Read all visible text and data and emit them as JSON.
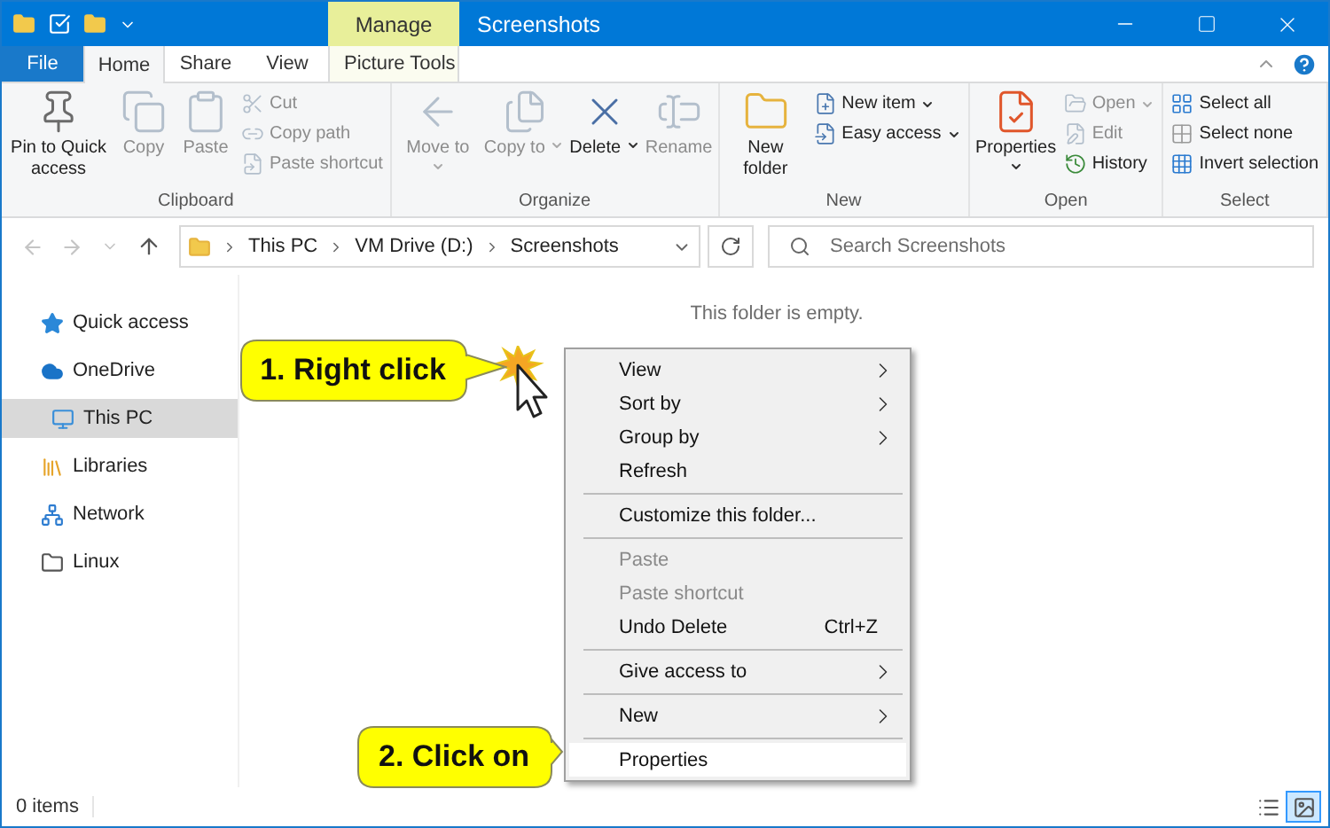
{
  "title_bar": {
    "contextual_tab": "Manage",
    "title": "Screenshots"
  },
  "ribbon_tabs": [
    {
      "label": "File",
      "kind": "file",
      "selected": false
    },
    {
      "label": "Home",
      "kind": "normal",
      "selected": true
    },
    {
      "label": "Share",
      "kind": "normal",
      "selected": false
    },
    {
      "label": "View",
      "kind": "normal",
      "selected": false
    },
    {
      "label": "Picture Tools",
      "kind": "contextual",
      "selected": false
    }
  ],
  "ribbon_groups": [
    {
      "label": "Clipboard",
      "items": [
        {
          "kind": "large",
          "label": "Pin to Quick access",
          "disabled": false,
          "dropdown": false
        },
        {
          "kind": "large",
          "label": "Copy",
          "disabled": true,
          "dropdown": false
        },
        {
          "kind": "large",
          "label": "Paste",
          "disabled": true,
          "dropdown": false
        },
        {
          "kind": "small",
          "label": "Cut",
          "disabled": true,
          "dropdown": false
        },
        {
          "kind": "small",
          "label": "Copy path",
          "disabled": true,
          "dropdown": false
        },
        {
          "kind": "small",
          "label": "Paste shortcut",
          "disabled": true,
          "dropdown": false
        }
      ]
    },
    {
      "label": "Organize",
      "items": [
        {
          "kind": "large",
          "label": "Move to",
          "disabled": true,
          "dropdown": true
        },
        {
          "kind": "large",
          "label": "Copy to",
          "disabled": true,
          "dropdown": true
        },
        {
          "kind": "large",
          "label": "Delete",
          "disabled": false,
          "dropdown": true
        },
        {
          "kind": "large",
          "label": "Rename",
          "disabled": true,
          "dropdown": false
        }
      ]
    },
    {
      "label": "New",
      "items": [
        {
          "kind": "large",
          "label": "New folder",
          "disabled": false,
          "dropdown": false
        },
        {
          "kind": "small",
          "label": "New item",
          "disabled": false,
          "dropdown": true
        },
        {
          "kind": "small",
          "label": "Easy access",
          "disabled": false,
          "dropdown": true
        }
      ]
    },
    {
      "label": "Open",
      "items": [
        {
          "kind": "large",
          "label": "Properties",
          "disabled": false,
          "dropdown": true
        },
        {
          "kind": "small",
          "label": "Open",
          "disabled": true,
          "dropdown": true
        },
        {
          "kind": "small",
          "label": "Edit",
          "disabled": true,
          "dropdown": false
        },
        {
          "kind": "small",
          "label": "History",
          "disabled": false,
          "dropdown": false
        }
      ]
    },
    {
      "label": "Select",
      "items": [
        {
          "kind": "small",
          "label": "Select all",
          "disabled": false,
          "dropdown": false
        },
        {
          "kind": "small",
          "label": "Select none",
          "disabled": false,
          "dropdown": false
        },
        {
          "kind": "small",
          "label": "Invert selection",
          "disabled": false,
          "dropdown": false
        }
      ]
    }
  ],
  "address_bar": {
    "path": [
      "This PC",
      "VM Drive (D:)",
      "Screenshots"
    ]
  },
  "search": {
    "placeholder": "Search Screenshots"
  },
  "navigation": [
    {
      "label": "Quick access",
      "selected": false
    },
    {
      "label": "OneDrive",
      "selected": false
    },
    {
      "label": "This PC",
      "selected": true
    },
    {
      "label": "Libraries",
      "selected": false
    },
    {
      "label": "Network",
      "selected": false
    },
    {
      "label": "Linux",
      "selected": false
    }
  ],
  "content": {
    "empty_message": "This folder is empty."
  },
  "context_menu": [
    {
      "kind": "item",
      "label": "View",
      "submenu": true,
      "disabled": false,
      "selected": false
    },
    {
      "kind": "item",
      "label": "Sort by",
      "submenu": true,
      "disabled": false,
      "selected": false
    },
    {
      "kind": "item",
      "label": "Group by",
      "submenu": true,
      "disabled": false,
      "selected": false
    },
    {
      "kind": "item",
      "label": "Refresh",
      "submenu": false,
      "disabled": false,
      "selected": false
    },
    {
      "kind": "separator"
    },
    {
      "kind": "item",
      "label": "Customize this folder...",
      "submenu": false,
      "disabled": false,
      "selected": false
    },
    {
      "kind": "separator"
    },
    {
      "kind": "item",
      "label": "Paste",
      "submenu": false,
      "disabled": true,
      "selected": false
    },
    {
      "kind": "item",
      "label": "Paste shortcut",
      "submenu": false,
      "disabled": true,
      "selected": false
    },
    {
      "kind": "item",
      "label": "Undo Delete",
      "submenu": false,
      "disabled": false,
      "selected": false,
      "shortcut": "Ctrl+Z"
    },
    {
      "kind": "separator"
    },
    {
      "kind": "item",
      "label": "Give access to",
      "submenu": true,
      "disabled": false,
      "selected": false
    },
    {
      "kind": "separator"
    },
    {
      "kind": "item",
      "label": "New",
      "submenu": true,
      "disabled": false,
      "selected": false
    },
    {
      "kind": "separator"
    },
    {
      "kind": "item",
      "label": "Properties",
      "submenu": false,
      "disabled": false,
      "selected": true
    }
  ],
  "callouts": [
    {
      "text": "1. Right click"
    },
    {
      "text": "2. Click on"
    }
  ],
  "status_bar": {
    "item_count": "0 items",
    "views": [
      {
        "selected": false
      },
      {
        "selected": true
      }
    ]
  }
}
